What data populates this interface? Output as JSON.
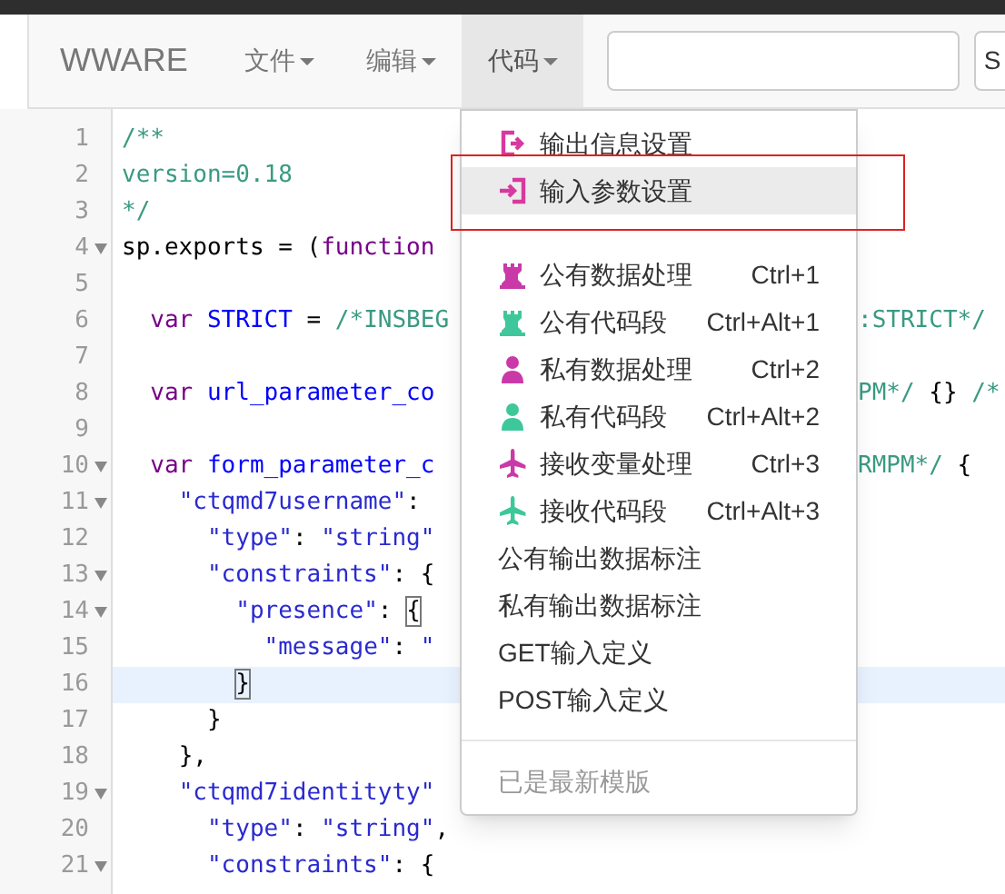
{
  "navbar": {
    "brand": "WWARE",
    "menus": [
      {
        "label": "文件",
        "selected": false
      },
      {
        "label": "编辑",
        "selected": false
      },
      {
        "label": "代码",
        "selected": true
      }
    ],
    "search": {
      "button": "S"
    }
  },
  "editor": {
    "lines": [
      {
        "number": "1",
        "foldable": false,
        "highlighted": false,
        "tokens": [
          {
            "text": "/**",
            "kind": "comment"
          }
        ]
      },
      {
        "number": "2",
        "foldable": false,
        "highlighted": false,
        "tokens": [
          {
            "text": "version=0.18",
            "kind": "comment"
          }
        ]
      },
      {
        "number": "3",
        "foldable": false,
        "highlighted": false,
        "tokens": [
          {
            "text": "*/",
            "kind": "comment"
          }
        ]
      },
      {
        "number": "4",
        "foldable": true,
        "highlighted": false,
        "tokens": [
          {
            "text": "sp.exports = (",
            "kind": "plain"
          },
          {
            "text": "function",
            "kind": "keyword"
          }
        ]
      },
      {
        "number": "5",
        "foldable": false,
        "highlighted": false
      },
      {
        "number": "6",
        "foldable": false,
        "highlighted": false,
        "tokens": [
          {
            "text": "  var",
            "kind": "keyword"
          },
          {
            "text": " STRICT",
            "kind": "def"
          },
          {
            "text": " = ",
            "kind": "plain"
          },
          {
            "text": "/*INSBEG",
            "kind": "comment"
          }
        ],
        "tail": [
          {
            "text": ":STRICT*/",
            "kind": "comment"
          }
        ]
      },
      {
        "number": "7",
        "foldable": false,
        "highlighted": false
      },
      {
        "number": "8",
        "foldable": false,
        "highlighted": false,
        "tokens": [
          {
            "text": "  var",
            "kind": "keyword"
          },
          {
            "text": " url_parameter_co",
            "kind": "def"
          }
        ],
        "tail": [
          {
            "text": "PM*/",
            "kind": "comment"
          },
          {
            "text": " {} ",
            "kind": "plain"
          },
          {
            "text": "/*",
            "kind": "comment"
          }
        ]
      },
      {
        "number": "9",
        "foldable": false,
        "highlighted": false
      },
      {
        "number": "10",
        "foldable": true,
        "highlighted": false,
        "tokens": [
          {
            "text": "  var",
            "kind": "keyword"
          },
          {
            "text": " form_parameter_c",
            "kind": "def"
          }
        ],
        "tail": [
          {
            "text": "RMPM*/",
            "kind": "comment"
          },
          {
            "text": " {",
            "kind": "plain"
          }
        ]
      },
      {
        "number": "11",
        "foldable": true,
        "highlighted": false,
        "tokens": [
          {
            "text": "    \"ctqmd7username\"",
            "kind": "string"
          },
          {
            "text": ":",
            "kind": "plain"
          }
        ]
      },
      {
        "number": "12",
        "foldable": false,
        "highlighted": false,
        "tokens": [
          {
            "text": "      \"type\"",
            "kind": "string"
          },
          {
            "text": ": ",
            "kind": "plain"
          },
          {
            "text": "\"string\"",
            "kind": "string"
          }
        ]
      },
      {
        "number": "13",
        "foldable": true,
        "highlighted": false,
        "tokens": [
          {
            "text": "      \"constraints\"",
            "kind": "string"
          },
          {
            "text": ": {",
            "kind": "plain"
          }
        ]
      },
      {
        "number": "14",
        "foldable": true,
        "highlighted": false,
        "tokens": [
          {
            "text": "        \"presence\"",
            "kind": "string"
          },
          {
            "text": ": ",
            "kind": "plain"
          },
          {
            "text": "{",
            "kind": "bracket"
          }
        ]
      },
      {
        "number": "15",
        "foldable": false,
        "highlighted": false,
        "tokens": [
          {
            "text": "          \"message\"",
            "kind": "string"
          },
          {
            "text": ": ",
            "kind": "plain"
          },
          {
            "text": "\"",
            "kind": "string"
          }
        ]
      },
      {
        "number": "16",
        "foldable": false,
        "highlighted": true,
        "tokens": [
          {
            "text": "        }",
            "kind": "bracket"
          }
        ]
      },
      {
        "number": "17",
        "foldable": false,
        "highlighted": false,
        "tokens": [
          {
            "text": "      }",
            "kind": "plain"
          }
        ]
      },
      {
        "number": "18",
        "foldable": false,
        "highlighted": false,
        "tokens": [
          {
            "text": "    },",
            "kind": "plain"
          }
        ]
      },
      {
        "number": "19",
        "foldable": true,
        "highlighted": false,
        "tokens": [
          {
            "text": "    \"ctqmd7identityty\"",
            "kind": "string"
          }
        ]
      },
      {
        "number": "20",
        "foldable": false,
        "highlighted": false,
        "tokens": [
          {
            "text": "      \"type\"",
            "kind": "string"
          },
          {
            "text": ": ",
            "kind": "plain"
          },
          {
            "text": "\"string\"",
            "kind": "string"
          },
          {
            "text": ",",
            "kind": "plain"
          }
        ]
      },
      {
        "number": "21",
        "foldable": true,
        "highlighted": false,
        "tokens": [
          {
            "text": "      \"constraints\"",
            "kind": "string"
          },
          {
            "text": ": {",
            "kind": "plain"
          }
        ]
      }
    ]
  },
  "dropdown": {
    "sections": [
      {
        "divider_before": false,
        "items": [
          {
            "label": "输出信息设置",
            "color": "#d63a9e",
            "highlighted": false,
            "disabled": false
          },
          {
            "label": "输入参数设置",
            "color": "#d63a9e",
            "highlighted": true,
            "disabled": false
          }
        ]
      },
      {
        "divider_before": false,
        "items": [
          {
            "label": "公有数据处理",
            "shortcut": "Ctrl+1",
            "color": "#c93aa8",
            "highlighted": false,
            "disabled": false
          },
          {
            "label": "公有代码段",
            "shortcut": "Ctrl+Alt+1",
            "color": "#3ec79a",
            "highlighted": false,
            "disabled": false
          },
          {
            "label": "私有数据处理",
            "shortcut": "Ctrl+2",
            "color": "#c93aa8",
            "highlighted": false,
            "disabled": false
          },
          {
            "label": "私有代码段",
            "shortcut": "Ctrl+Alt+2",
            "color": "#3ec79a",
            "highlighted": false,
            "disabled": false
          },
          {
            "label": "接收变量处理",
            "shortcut": "Ctrl+3",
            "color": "#c93aa8",
            "highlighted": false,
            "disabled": false
          },
          {
            "label": "接收代码段",
            "shortcut": "Ctrl+Alt+3",
            "color": "#3ec79a",
            "highlighted": false,
            "disabled": false
          },
          {
            "label": "公有输出数据标注",
            "highlighted": false,
            "disabled": false
          },
          {
            "label": "私有输出数据标注",
            "highlighted": false,
            "disabled": false
          },
          {
            "label": "GET输入定义",
            "highlighted": false,
            "disabled": false
          },
          {
            "label": "POST输入定义",
            "highlighted": false,
            "disabled": false
          }
        ]
      },
      {
        "divider_before": true,
        "items": [
          {
            "label": "已是最新模版",
            "highlighted": false,
            "disabled": true
          }
        ]
      }
    ]
  }
}
